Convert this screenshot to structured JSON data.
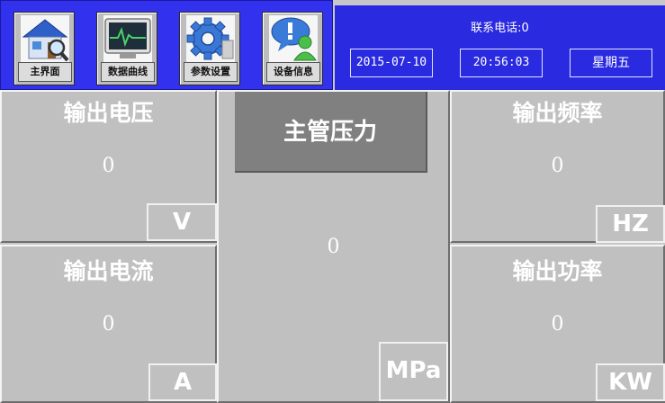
{
  "nav": {
    "buttons": [
      {
        "label": "主界面",
        "icon": "house-search-icon"
      },
      {
        "label": "数据曲线",
        "icon": "monitor-curve-icon"
      },
      {
        "label": "参数设置",
        "icon": "gear-icon"
      },
      {
        "label": "设备信息",
        "icon": "user-info-icon"
      }
    ]
  },
  "header": {
    "contact": "联系电话:0",
    "date": "2015-07-10",
    "time": "20:56:03",
    "weekday": "星期五"
  },
  "panels": {
    "output_voltage": {
      "title": "输出电压",
      "value": "0",
      "unit": "V"
    },
    "output_current": {
      "title": "输出电流",
      "value": "0",
      "unit": "A"
    },
    "main_pressure": {
      "title": "主管压力",
      "value": "0",
      "unit": "MPa"
    },
    "output_frequency": {
      "title": "输出频率",
      "value": "0",
      "unit": "HZ"
    },
    "output_power": {
      "title": "输出功率",
      "value": "0",
      "unit": "KW"
    }
  },
  "colors": {
    "nav_bg": "#3131ee",
    "info_bg": "#2a2ae0",
    "panel_bg": "#c0c0c0",
    "center_title_bg": "#808080"
  }
}
